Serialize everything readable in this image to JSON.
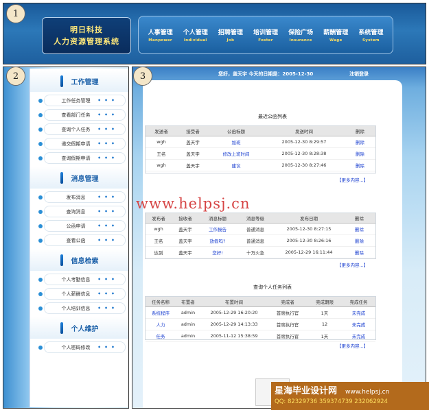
{
  "header": {
    "logo_line1": "明日科技",
    "logo_line2": "人力资源管理系统",
    "nav": [
      {
        "cn": "人事管理",
        "en": "Manpower"
      },
      {
        "cn": "个人管理",
        "en": "Individual"
      },
      {
        "cn": "招聘管理",
        "en": "Job"
      },
      {
        "cn": "培训管理",
        "en": "Foster"
      },
      {
        "cn": "保险广场",
        "en": "Insurance"
      },
      {
        "cn": "薪酬管理",
        "en": "Wage"
      },
      {
        "cn": "系统管理",
        "en": "System"
      }
    ]
  },
  "markers": {
    "one": "1",
    "two": "2",
    "three": "3"
  },
  "sidebar": {
    "groups": [
      {
        "title": "工作管理",
        "items": [
          "工作任务管理",
          "查看部门任务",
          "查询个人任务",
          "递交假期申请",
          "查询假期申请"
        ]
      },
      {
        "title": "消息管理",
        "items": [
          "发布消息",
          "查询消息",
          "公函申请",
          "查看公函"
        ]
      },
      {
        "title": "信息检索",
        "items": [
          "个人考勤信息",
          "个人薪酬信息",
          "个人培训信息"
        ]
      },
      {
        "title": "个人维护",
        "items": [
          "个人密码修改"
        ]
      }
    ],
    "more_glyph": "• • •"
  },
  "main": {
    "welcome": "您好，盖天宇    今天的日期是：2005-12-30",
    "logout": "注销登录",
    "watermark": "www.helpsj.cn",
    "more_link": "【更多内容...】",
    "letters": {
      "title": "最近公函列表",
      "headers": [
        "发送者",
        "接受者",
        "公函标题",
        "发送时间",
        "删除"
      ],
      "rows": [
        [
          "wgh",
          "盖天宇",
          "加班",
          "2005-12-30 8:29:57",
          "删除"
        ],
        [
          "王名",
          "盖天宇",
          "修改上班时间",
          "2005-12-30 8:28:38",
          "删除"
        ],
        [
          "wgh",
          "盖天宇",
          "建议",
          "2005-12-30 8:27:46",
          "删除"
        ]
      ]
    },
    "messages": {
      "headers": [
        "发布者",
        "接收者",
        "消息标题",
        "消息等级",
        "发布日期",
        "删除"
      ],
      "rows": [
        [
          "wgh",
          "盖天宇",
          "工作报告",
          "普通消息",
          "2005-12-30 8:27:15",
          "删除"
        ],
        [
          "王名",
          "盖天宇",
          "放假吗?",
          "普通消息",
          "2005-12-30 8:26:16",
          "删除"
        ],
        [
          "达到",
          "盖天宇",
          "您好!",
          "十万火急",
          "2005-12-29 16:11:44",
          "删除"
        ]
      ]
    },
    "tasks": {
      "title": "查询个人任务列表",
      "headers": [
        "任务名称",
        "布置者",
        "布置时间",
        "完成者",
        "完成期限",
        "完成任务"
      ],
      "rows": [
        [
          "系统程序",
          "admin",
          "2005-12-29 16:20:20",
          "首席执行官",
          "1天",
          "未完成"
        ],
        [
          "人力",
          "admin",
          "2005-12-29 14:13:33",
          "首席执行官",
          "12",
          "未完成"
        ],
        [
          "任务",
          "admin",
          "2005-11-12 15:38:59",
          "首席执行官",
          "1天",
          "未完成"
        ]
      ]
    }
  },
  "footer": {
    "site_name": "星海毕业设计网",
    "site_url": "www.helpsj.cn",
    "qq": "QQ: 82329736  359374739  232062924"
  }
}
